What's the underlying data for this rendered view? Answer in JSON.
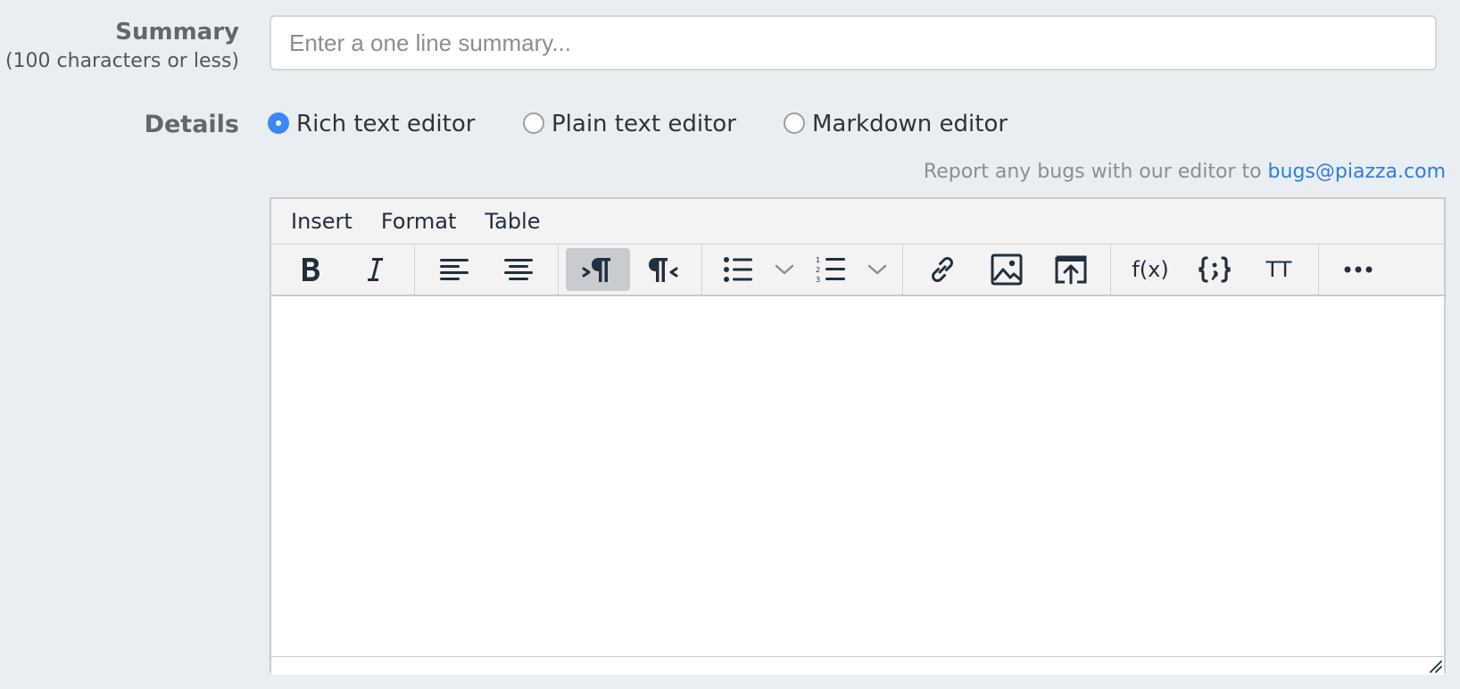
{
  "summary": {
    "label": "Summary",
    "sublabel": "(100 characters or less)",
    "placeholder": "Enter a one line summary...",
    "value": ""
  },
  "details": {
    "label": "Details",
    "editor_options": [
      {
        "label": "Rich text editor",
        "selected": true
      },
      {
        "label": "Plain text editor",
        "selected": false
      },
      {
        "label": "Markdown editor",
        "selected": false
      }
    ],
    "bug_note_prefix": "Report any bugs with our editor to",
    "bug_note_email": "bugs@piazza.com"
  },
  "editor": {
    "menu": [
      "Insert",
      "Format",
      "Table"
    ],
    "toolbar": {
      "bold": "bold-icon",
      "italic": "italic-icon",
      "align_left": "align-left-icon",
      "align_center": "align-center-icon",
      "ltr": "ltr-icon",
      "rtl": "rtl-icon",
      "bullet_list": "bullet-list-icon",
      "numbered_list": "numbered-list-icon",
      "link": "link-icon",
      "image": "image-icon",
      "upload": "upload-icon",
      "formula_label": "f(x)",
      "code": "code-braces-icon",
      "tt_label": "TT",
      "more": "more-icon"
    }
  },
  "colors": {
    "background": "#e9eef2",
    "accent": "#3b88f5",
    "link": "#2f7ed8",
    "toolbar_active": "#c8ccd0"
  }
}
